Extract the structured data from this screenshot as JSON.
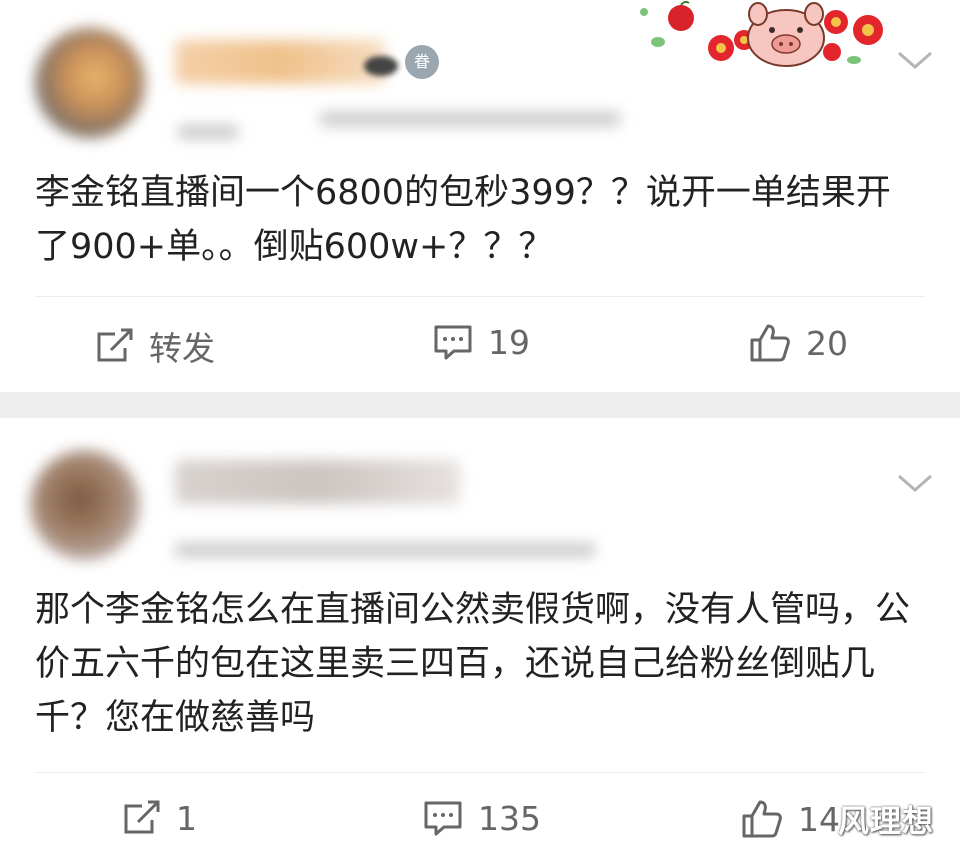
{
  "posts": [
    {
      "text": "李金铭直播间一个6800的包秒399？？说开一单结果开了900+单。。倒贴600w+？？？",
      "badge_glyph": "眷",
      "repost_label": "转发",
      "comment_count": "19",
      "like_count": "20"
    },
    {
      "text": "那个李金铭怎么在直播间公然卖假货啊，没有人管吗，公价五六千的包在这里卖三四百，还说自己给粉丝倒贴几千？您在做慈善吗",
      "repost_count": "1",
      "comment_count": "135",
      "like_count": "14"
    }
  ],
  "watermark": "风理想",
  "icons": {
    "repost": "repost-icon",
    "comment": "comment-icon",
    "like": "thumbs-up-icon",
    "more": "chevron-down-icon"
  },
  "colors": {
    "text": "#222222",
    "action_text": "#666666",
    "separator": "#eeeeee",
    "badge": "#9aa7b1"
  }
}
